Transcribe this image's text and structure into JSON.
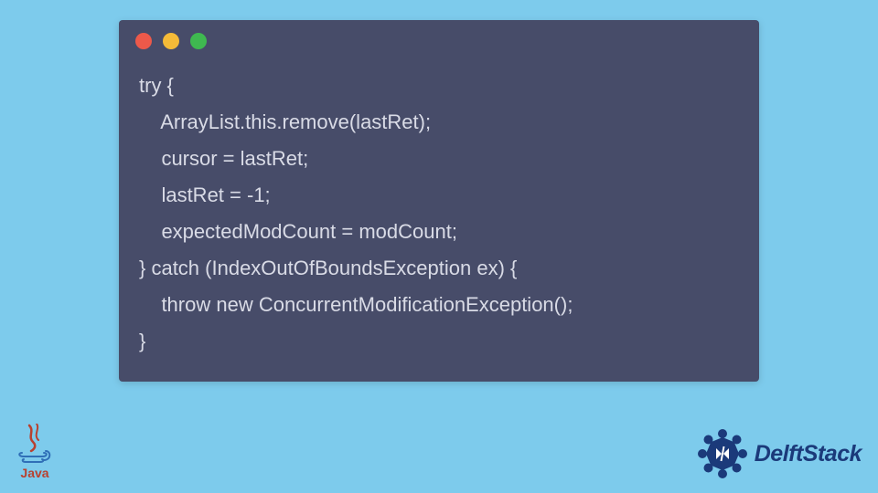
{
  "window": {
    "dots": [
      "red",
      "yellow",
      "green"
    ]
  },
  "code": {
    "lines": [
      "try {",
      "    ArrayList.this.remove(lastRet);",
      "    cursor = lastRet;",
      "    lastRet = -1;",
      "    expectedModCount = modCount;",
      "} catch (IndexOutOfBoundsException ex) {",
      "    throw new ConcurrentModificationException();",
      "}"
    ]
  },
  "footer": {
    "java_label": "Java",
    "delft_label": "DelftStack"
  },
  "colors": {
    "page_bg": "#7dcbec",
    "window_bg": "#474c69",
    "code_text": "#d9dbe6",
    "java_red": "#b8412f",
    "java_blue": "#2f6fb7",
    "delft_blue": "#1b3a7a"
  }
}
